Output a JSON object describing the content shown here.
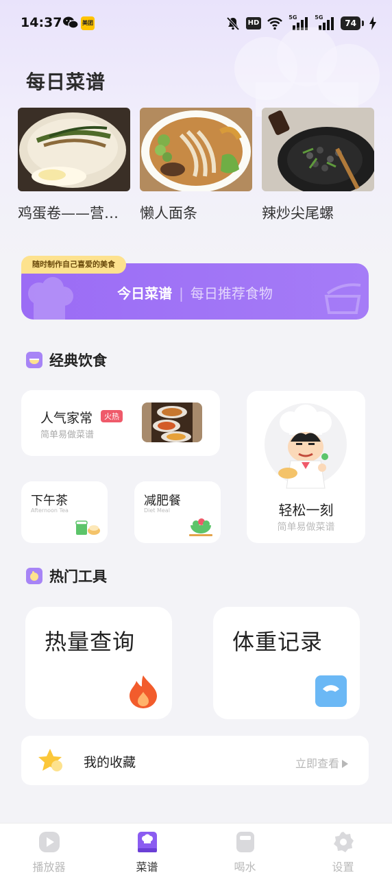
{
  "status_bar": {
    "time": "14:37",
    "meituan_label": "美团",
    "hd_label": "HD",
    "network_labels": [
      "5G",
      "5G"
    ],
    "battery": "74"
  },
  "daily": {
    "title": "每日菜谱",
    "recipes": [
      {
        "name": "鸡蛋卷——营养早餐",
        "image": "egg-roll-photo"
      },
      {
        "name": "懒人面条",
        "image": "noodles-photo"
      },
      {
        "name": "辣炒尖尾螺",
        "image": "stir-fried-snail-photo"
      }
    ]
  },
  "banner": {
    "tag": "随时制作自己喜爱的美食",
    "main": "今日菜谱",
    "separator": "|",
    "sub": "每日推荐食物"
  },
  "classic": {
    "title": "经典饮食",
    "popular": {
      "title": "人气家常",
      "badge": "火热",
      "sub": "简单易做菜谱"
    },
    "tea": {
      "title": "下午茶",
      "sub": "Afternoon Tea"
    },
    "diet": {
      "title": "减肥餐",
      "sub": "Diet Meal"
    },
    "easy": {
      "title": "轻松一刻",
      "sub": "简单易做菜谱"
    }
  },
  "tools": {
    "title": "热门工具",
    "calorie": "热量查询",
    "weight": "体重记录"
  },
  "favorites": {
    "label": "我的收藏",
    "action": "立即查看"
  },
  "tabbar": {
    "items": [
      {
        "label": "播放器",
        "icon": "play-icon",
        "active": false
      },
      {
        "label": "菜谱",
        "icon": "recipe-book-icon",
        "active": true
      },
      {
        "label": "喝水",
        "icon": "water-icon",
        "active": false
      },
      {
        "label": "设置",
        "icon": "gear-icon",
        "active": false
      }
    ]
  },
  "colors": {
    "accent": "#9b6cf5",
    "banner_tag": "#fde28e",
    "hot": "#ef5a6a",
    "flame": "#f25c2c",
    "scale": "#6bb8f5"
  }
}
